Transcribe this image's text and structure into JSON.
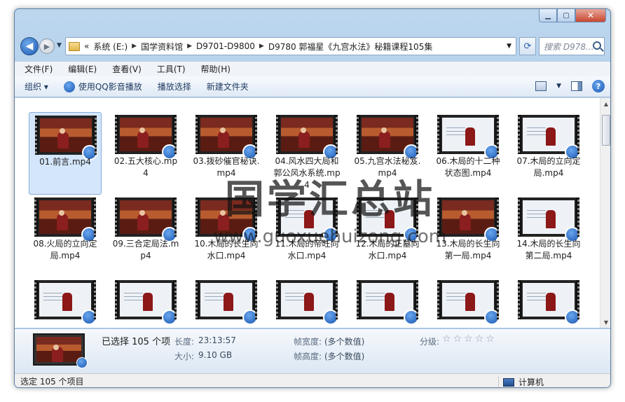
{
  "window": {
    "close_label": "✕",
    "min_label": "▁",
    "max_label": "▢"
  },
  "nav": {
    "back_label": "◀",
    "forward_label": "▶",
    "overflow": "«",
    "breadcrumbs": [
      "系统 (E:)",
      "国学资料馆",
      "D9701-D9800",
      "D9780 郭福星《九宫水法》秘籍课程105集"
    ],
    "search_placeholder": "搜索 D978..."
  },
  "menu": [
    "文件(F)",
    "编辑(E)",
    "查看(V)",
    "工具(T)",
    "帮助(H)"
  ],
  "commands": {
    "organize": "组织 ▾",
    "play_qq": "使用QQ影音播放",
    "play_selection": "播放选择",
    "new_folder": "新建文件夹"
  },
  "files": [
    {
      "name": "01.前言.mp4",
      "scene": "studio"
    },
    {
      "name": "02.五大核心.mp4",
      "scene": "studio"
    },
    {
      "name": "03.拨砂催官秘诀.mp4",
      "scene": "studio"
    },
    {
      "name": "04.风水四大局和郭公风水系统.mp4",
      "scene": "studio"
    },
    {
      "name": "05.九宫水法秘笈.mp4",
      "scene": "studio"
    },
    {
      "name": "06.木局的十二种状态图.mp4",
      "scene": "board"
    },
    {
      "name": "07.木局的立向定局.mp4",
      "scene": "board"
    },
    {
      "name": "08.火局的立向定局.mp4",
      "scene": "studio"
    },
    {
      "name": "09.三合定局法.mp4",
      "scene": "studio"
    },
    {
      "name": "10.木局的长生向水口.mp4",
      "scene": "studio"
    },
    {
      "name": "11.木局的帝旺向水口.mp4",
      "scene": "board"
    },
    {
      "name": "12.木局的正墓向水口.mp4",
      "scene": "board"
    },
    {
      "name": "13.木局的长生向第一局.mp4",
      "scene": "studio"
    },
    {
      "name": "14.木局的长生向第二局.mp4",
      "scene": "board"
    },
    {
      "name": "",
      "scene": "board"
    },
    {
      "name": "",
      "scene": "board"
    },
    {
      "name": "",
      "scene": "board"
    },
    {
      "name": "",
      "scene": "board"
    },
    {
      "name": "",
      "scene": "board"
    },
    {
      "name": "",
      "scene": "board"
    },
    {
      "name": "",
      "scene": "board"
    }
  ],
  "watermark": {
    "title": "国学汇总站",
    "url": "www.guoxuehuizong.com"
  },
  "details": {
    "selected": "已选择 105 个项",
    "length_label": "长度:",
    "length": "23:13:57",
    "size_label": "大小:",
    "size": "9.10 GB",
    "width_label": "帧宽度:",
    "width": "(多个数值)",
    "height_label": "帧高度:",
    "height": "(多个数值)",
    "rating_label": "分级:",
    "rating": 0
  },
  "status": {
    "left": "选定 105 个项目",
    "right": "计算机"
  }
}
